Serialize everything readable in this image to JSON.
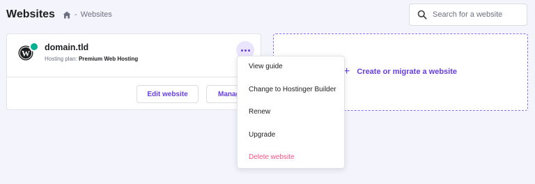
{
  "header": {
    "title": "Websites",
    "breadcrumb": {
      "home_icon": "home-icon",
      "separator": "-",
      "current": "Websites"
    },
    "search": {
      "placeholder": "Search for a website",
      "value": "",
      "icon": "search-icon"
    }
  },
  "site_card": {
    "domain": "domain.tld",
    "plan_label": "Hosting plan:",
    "plan_value": "Premium Web Hosting",
    "logo": "wordpress-icon",
    "status_color": "#00b090",
    "edit_label": "Edit website",
    "manage_label": "Manage"
  },
  "create_card": {
    "label": "Create or migrate a website",
    "icon": "plus-icon"
  },
  "menu": {
    "items": [
      "View guide",
      "Change to Hostinger Builder",
      "Renew",
      "Upgrade",
      "Delete website"
    ]
  },
  "colors": {
    "accent": "#673de6",
    "danger": "#fc5185",
    "background": "#f4f4fc"
  }
}
